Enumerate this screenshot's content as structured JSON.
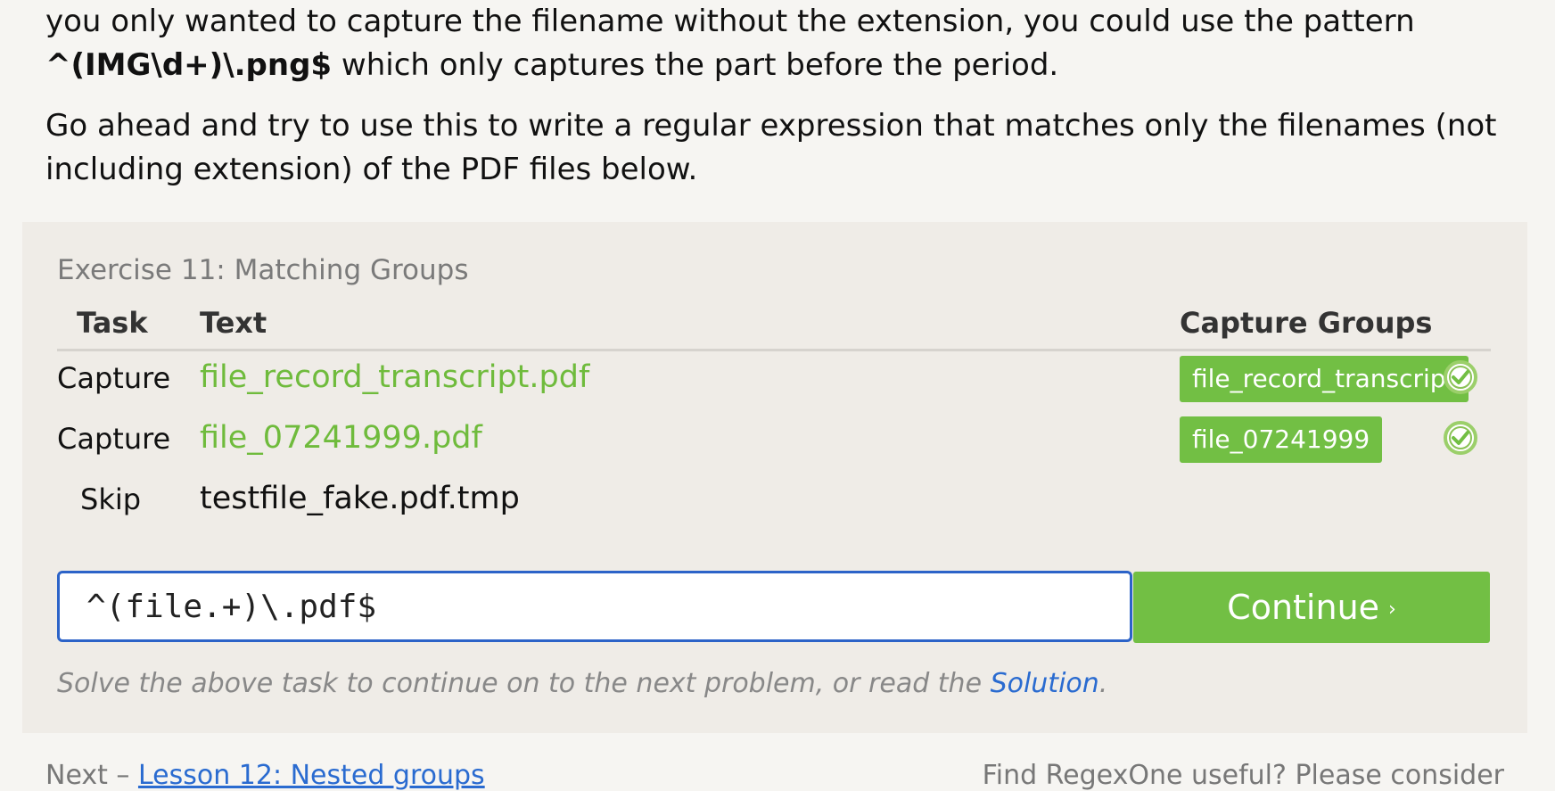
{
  "intro": {
    "line1": "you only wanted to capture the filename without the extension, you could use the pattern",
    "pattern_example": "^(IMG\\d+)\\.png$",
    "line2_rest": " which only captures the part before the period.",
    "para2": "Go ahead and try to use this to write a regular expression that matches only the filenames (not including extension) of the PDF files below."
  },
  "exercise": {
    "title": "Exercise 11: Matching Groups",
    "headers": {
      "task": "Task",
      "text": "Text",
      "groups": "Capture Groups"
    },
    "rows": [
      {
        "task": "Capture",
        "text": "file_record_transcript.pdf",
        "group": "file_record_transcript",
        "status": "matched"
      },
      {
        "task": "Capture",
        "text": "file_07241999.pdf",
        "group": "file_07241999",
        "status": "matched"
      },
      {
        "task": "Skip",
        "text": "testfile_fake.pdf.tmp",
        "group": "",
        "status": "none"
      }
    ],
    "input_value": "^(file.+)\\.pdf$",
    "continue_label": "Continue",
    "continue_arrow": "›",
    "hint_prefix": "Solve the above task to continue on to the next problem, or read the ",
    "hint_link": "Solution",
    "hint_suffix": "."
  },
  "footer": {
    "next_prefix": "Next – ",
    "next_link": "Lesson 12: Nested groups",
    "right_text": "Find RegexOne useful? Please consider"
  },
  "colors": {
    "accent_green": "#72bf44",
    "link_blue": "#2a6bd0",
    "input_border": "#2c63c8"
  },
  "icons": {
    "check": "check-circle-icon"
  }
}
